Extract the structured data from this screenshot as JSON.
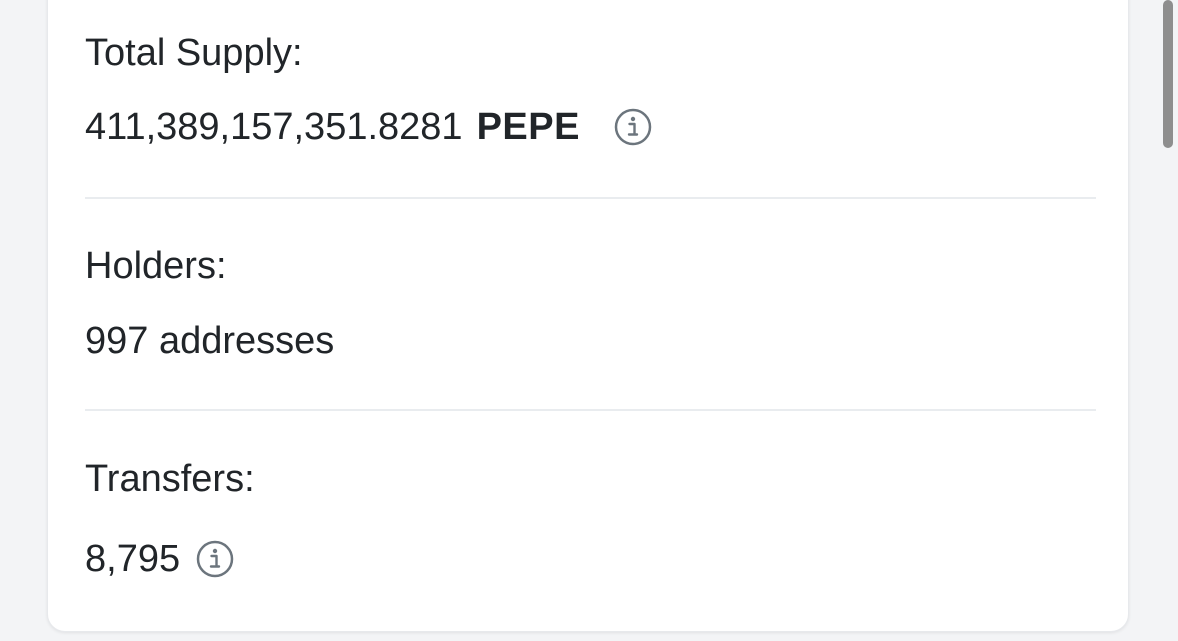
{
  "token_stats": {
    "total_supply": {
      "label": "Total Supply:",
      "amount": "411,389,157,351.8281",
      "symbol": "PEPE",
      "icon": "info-icon"
    },
    "holders": {
      "label": "Holders:",
      "value": "997 addresses"
    },
    "transfers": {
      "label": "Transfers:",
      "value": "8,795",
      "icon": "info-icon"
    }
  },
  "colors": {
    "background": "#f3f4f6",
    "card": "#ffffff",
    "text": "#212529",
    "icon": "#6c757d",
    "divider": "#e9ecef"
  }
}
